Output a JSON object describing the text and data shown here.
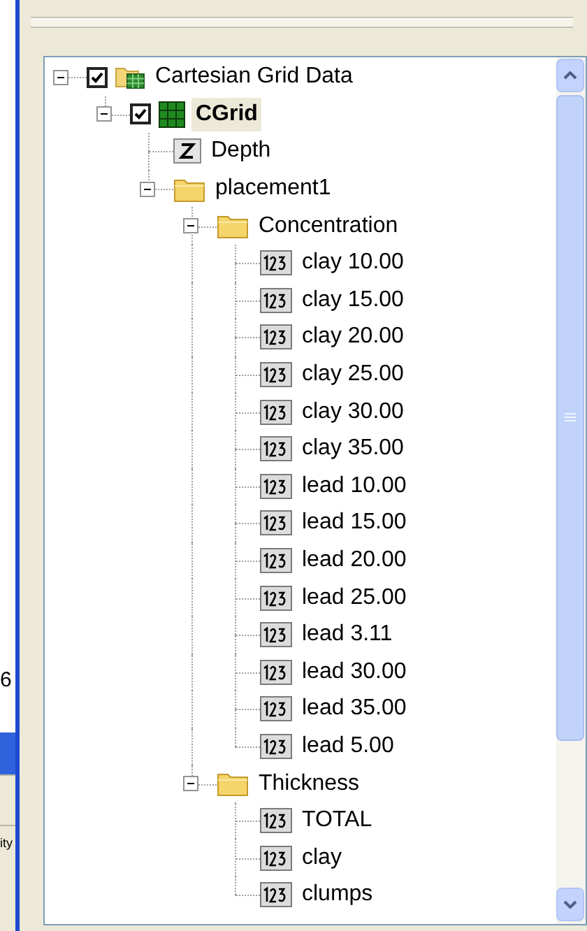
{
  "side_panel": {
    "texts": [
      "6",
      "ity"
    ]
  },
  "tree": [
    {
      "label": "Cartesian Grid Data",
      "kind": "grid-folder",
      "expanded": true,
      "checked": true,
      "selected": false,
      "children": [
        {
          "label": "CGrid",
          "kind": "grid",
          "expanded": true,
          "checked": true,
          "selected": true,
          "children": [
            {
              "label": "Depth",
              "kind": "z",
              "selected": false
            },
            {
              "label": "placement1",
              "kind": "folder",
              "expanded": true,
              "selected": false,
              "children": [
                {
                  "label": "Concentration",
                  "kind": "folder",
                  "expanded": true,
                  "selected": false,
                  "children": [
                    {
                      "label": "clay 10.00",
                      "kind": "number",
                      "selected": false
                    },
                    {
                      "label": "clay 15.00",
                      "kind": "number",
                      "selected": false
                    },
                    {
                      "label": "clay 20.00",
                      "kind": "number",
                      "selected": false
                    },
                    {
                      "label": "clay 25.00",
                      "kind": "number",
                      "selected": false
                    },
                    {
                      "label": "clay 30.00",
                      "kind": "number",
                      "selected": false
                    },
                    {
                      "label": "clay 35.00",
                      "kind": "number",
                      "selected": false
                    },
                    {
                      "label": "lead 10.00",
                      "kind": "number",
                      "selected": false
                    },
                    {
                      "label": "lead 15.00",
                      "kind": "number",
                      "selected": false
                    },
                    {
                      "label": "lead 20.00",
                      "kind": "number",
                      "selected": false
                    },
                    {
                      "label": "lead 25.00",
                      "kind": "number",
                      "selected": false
                    },
                    {
                      "label": "lead 3.11",
                      "kind": "number",
                      "selected": false
                    },
                    {
                      "label": "lead 30.00",
                      "kind": "number",
                      "selected": false
                    },
                    {
                      "label": "lead 35.00",
                      "kind": "number",
                      "selected": false
                    },
                    {
                      "label": "lead 5.00",
                      "kind": "number",
                      "selected": false
                    }
                  ]
                },
                {
                  "label": "Thickness",
                  "kind": "folder",
                  "expanded": true,
                  "selected": false,
                  "children": [
                    {
                      "label": "TOTAL",
                      "kind": "number",
                      "selected": false
                    },
                    {
                      "label": "clay",
                      "kind": "number",
                      "selected": false
                    },
                    {
                      "label": "clumps",
                      "kind": "number",
                      "selected": false
                    }
                  ]
                }
              ]
            }
          ]
        }
      ]
    }
  ]
}
